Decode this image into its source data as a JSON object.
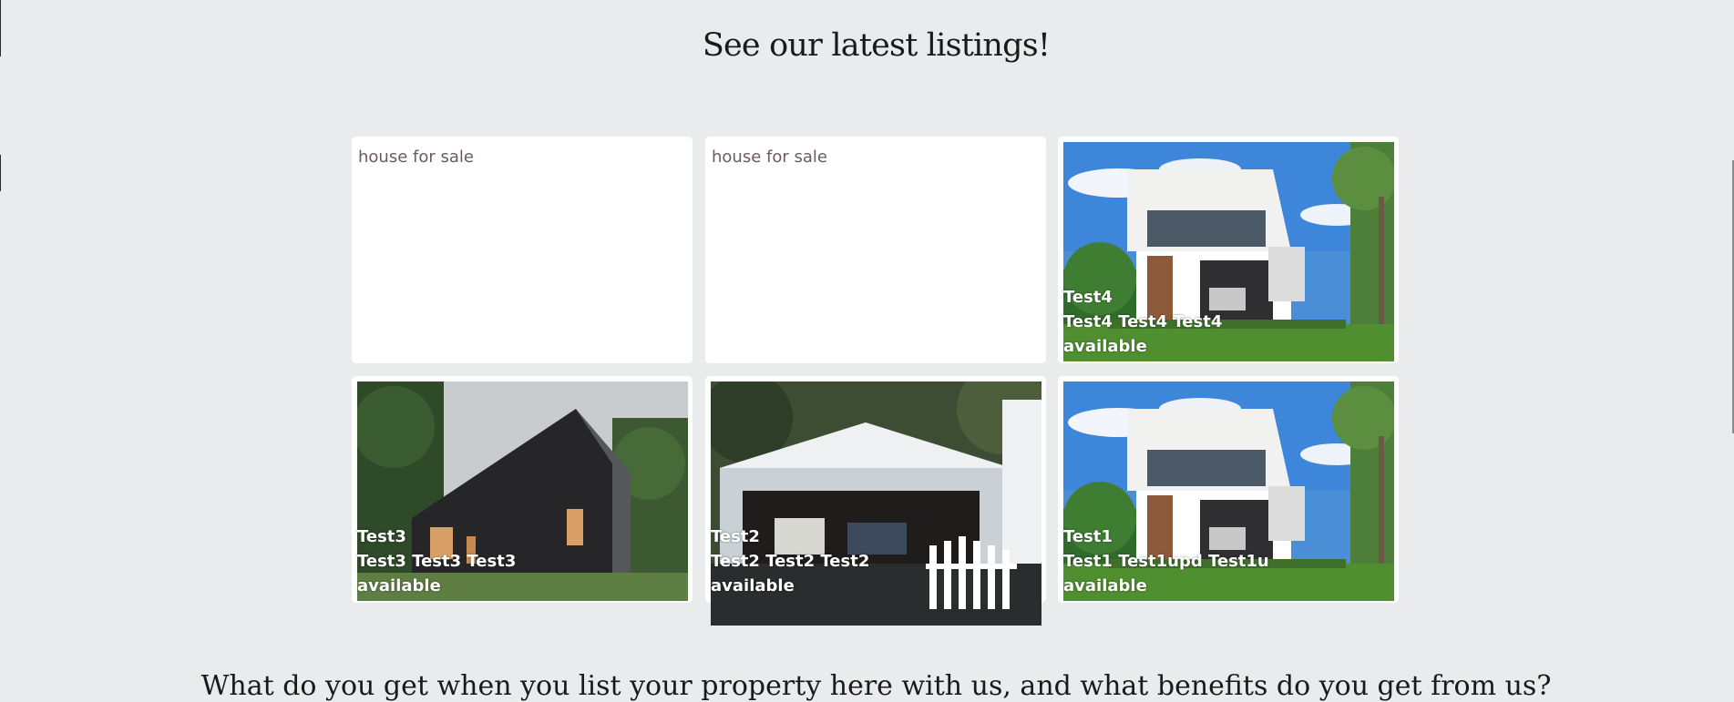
{
  "section": {
    "heading": "See our latest listings!",
    "footer_heading": "What do you get when you list your property here with us, and what benefits do you get from us?"
  },
  "listings": [
    {
      "alt": "house for sale",
      "image_loaded": false
    },
    {
      "alt": "house for sale",
      "image_loaded": false
    },
    {
      "name": "Test4",
      "description": "Test4 Test4 Test4",
      "status": "available",
      "image": "modern-white-villa"
    },
    {
      "name": "Test3",
      "description": "Test3 Test3 Test3",
      "status": "available",
      "image": "black-barn-house"
    },
    {
      "name": "Test2",
      "description": "Test2 Test2 Test2",
      "status": "available",
      "image": "white-garage"
    },
    {
      "name": "Test1",
      "description": "Test1 Test1upd Test1u",
      "status": "available",
      "image": "modern-white-villa"
    }
  ],
  "colors": {
    "page_background": "#e9ebed",
    "card_background": "#ffffff",
    "caption_text": "#ffffff"
  }
}
